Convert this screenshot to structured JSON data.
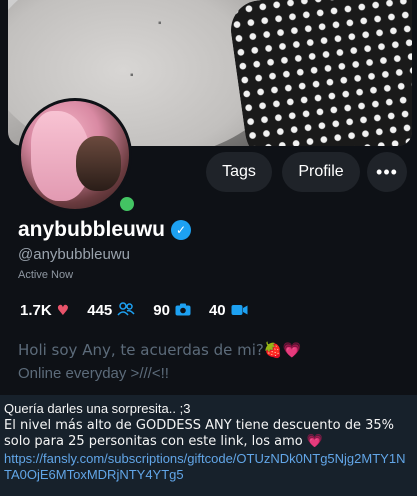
{
  "profile": {
    "buttons": {
      "tags": "Tags",
      "profile": "Profile",
      "more": "•••"
    },
    "display_name": "anybubbleuwu",
    "verified_mark": "✓",
    "handle": "@anybubbleuwu",
    "status": "Active Now",
    "stats": {
      "likes": "1.7K",
      "subscribers": "445",
      "photos": "90",
      "videos": "40"
    },
    "icons": {
      "likes": "heart-icon",
      "subscribers": "users-icon",
      "photos": "camera-icon",
      "videos": "video-camera-icon"
    },
    "bio": {
      "line1": "Holi soy Any, te acuerdas de mi?🍓💗",
      "line2": "Online everyday >///<!!"
    }
  },
  "message": {
    "line1": "Quería darles una sorpresita.. ;3",
    "line2": "El nivel más alto de GODDESS ANY tiene descuento de 35% solo para 25 personitas con este link, los amo 💗",
    "link": "https://fansly.com/subscriptions/giftcode/OTUzNDk0NTg5Njg2MTY1NTA0OjE6MToxMDRjNTY4YTg5"
  },
  "colors": {
    "card_bg": "#0e1116",
    "chat_bg": "#17212b",
    "accent_blue": "#1da1f2",
    "online_green": "#43c463",
    "link": "#62a6e8"
  }
}
